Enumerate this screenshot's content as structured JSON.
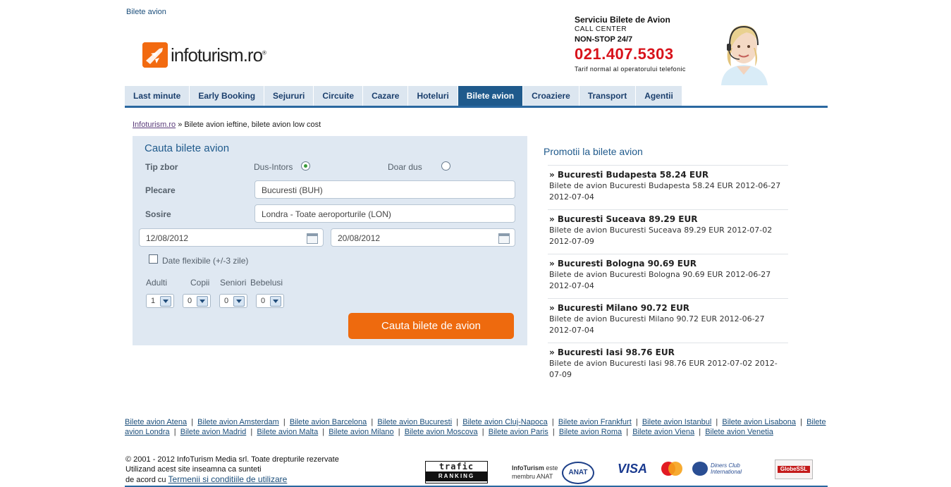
{
  "header": {
    "top_link": "Bilete avion",
    "logo_text": "infoturism.ro",
    "callcenter": {
      "title": "Serviciu Bilete de Avion",
      "line1": "CALL CENTER",
      "line2": "NON-STOP 24/7",
      "phone": "021.407.5303",
      "note": "Tarif normal al operatorului telefonic"
    }
  },
  "nav": [
    {
      "label": "Last minute",
      "active": false
    },
    {
      "label": "Early Booking",
      "active": false
    },
    {
      "label": "Sejururi",
      "active": false
    },
    {
      "label": "Circuite",
      "active": false
    },
    {
      "label": "Cazare",
      "active": false
    },
    {
      "label": "Hoteluri",
      "active": false
    },
    {
      "label": "Bilete avion",
      "active": true
    },
    {
      "label": "Croaziere",
      "active": false
    },
    {
      "label": "Transport",
      "active": false
    },
    {
      "label": "Agentii",
      "active": false
    }
  ],
  "breadcrumb": {
    "home": "Infoturism.ro",
    "current": "» Bilete avion ieftine, bilete avion low cost"
  },
  "search": {
    "title": "Cauta bilete avion",
    "trip_type_label": "Tip zbor",
    "round_trip": "Dus-Intors",
    "one_way": "Doar dus",
    "selected_trip": "Dus-Intors",
    "from_label": "Plecare",
    "from_value": "Bucuresti (BUH)",
    "to_label": "Sosire",
    "to_value": "Londra - Toate aeroporturile (LON)",
    "depart_date": "12/08/2012",
    "return_date": "20/08/2012",
    "flexible_label": "Date flexibile (+/-3 zile)",
    "flexible_checked": false,
    "pax_labels": {
      "adults": "Adulti",
      "children": "Copii",
      "seniors": "Seniori",
      "infants": "Bebelusi"
    },
    "pax_values": {
      "adults": "1",
      "children": "0",
      "seniors": "0",
      "infants": "0"
    },
    "submit_label": "Cauta bilete de avion"
  },
  "promos": {
    "title": "Promotii la bilete avion",
    "items": [
      {
        "head": "» Bucuresti Budapesta 58.24 EUR",
        "desc": "Bilete de avion Bucuresti Budapesta 58.24 EUR 2012-06-27 2012-07-04"
      },
      {
        "head": "» Bucuresti Suceava 89.29 EUR",
        "desc": "Bilete de avion Bucuresti Suceava 89.29 EUR 2012-07-02 2012-07-09"
      },
      {
        "head": "» Bucuresti Bologna 90.69 EUR",
        "desc": "Bilete de avion Bucuresti Bologna 90.69 EUR 2012-06-27 2012-07-04"
      },
      {
        "head": "» Bucuresti Milano 90.72 EUR",
        "desc": "Bilete de avion Bucuresti Milano 90.72 EUR 2012-06-27 2012-07-04"
      },
      {
        "head": "» Bucuresti Iasi 98.76 EUR",
        "desc": "Bilete de avion Bucuresti Iasi 98.76 EUR 2012-07-02 2012-07-09"
      }
    ]
  },
  "footer": {
    "links": [
      "Bilete avion Atena",
      "Bilete avion Amsterdam",
      "Bilete avion Barcelona",
      "Bilete avion Bucuresti",
      "Bilete avion Cluj-Napoca",
      "Bilete avion Frankfurt",
      "Bilete avion Istanbul",
      "Bilete avion Lisabona",
      "Bilete avion Londra",
      "Bilete avion Madrid",
      "Bilete avion Malta",
      "Bilete avion Milano",
      "Bilete avion Moscova",
      "Bilete avion Paris",
      "Bilete avion Roma",
      "Bilete avion Viena",
      "Bilete avion Venetia"
    ],
    "copyright": "© 2001 - 2012 InfoTurism Media srl. Toate drepturile rezervate",
    "usage1": "Utilizand acest site inseamna ca sunteti",
    "usage2": "de acord cu",
    "terms": "Termenii si conditiile de utilizare",
    "trafic_top": "trafic",
    "trafic_bottom": "RANKING",
    "anat_brand": "InfoTurism",
    "anat_text1": "este",
    "anat_text2": "membru ANAT",
    "anat_badge": "ANAT",
    "visa": "VISA",
    "mastercard": "MasterCard",
    "diners": "Diners Club International",
    "globessl": "GlobeSSL"
  },
  "colors": {
    "accent": "#1f5a8c",
    "orange": "#ee6a0e",
    "phone": "#d8121b",
    "panel": "#dfe8f2"
  }
}
